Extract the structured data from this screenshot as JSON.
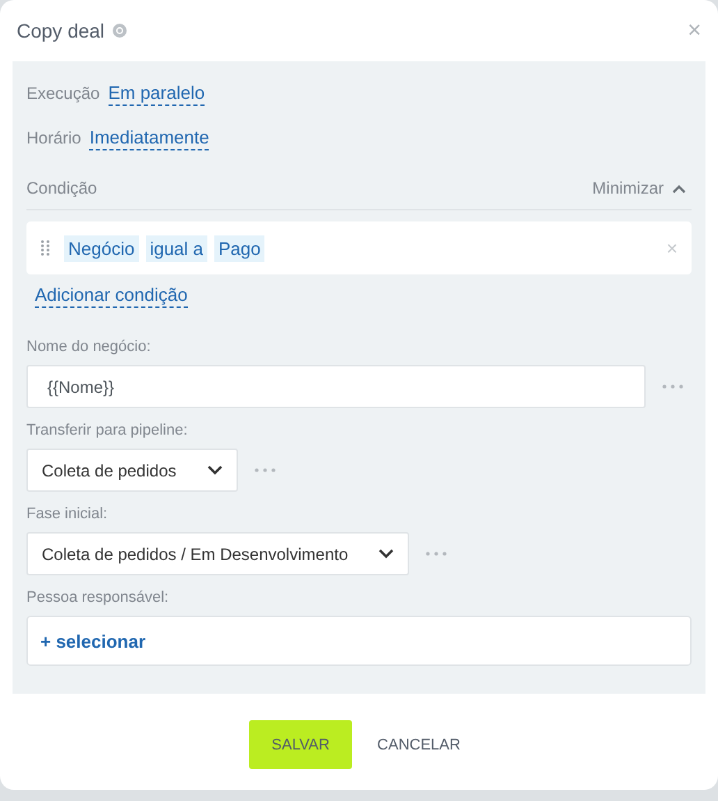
{
  "window": {
    "title": "Copy deal",
    "close": "×"
  },
  "settings": [
    {
      "label": "Execução",
      "value": "Em paralelo"
    },
    {
      "label": "Horário",
      "value": "Imediatamente"
    }
  ],
  "condition": {
    "label": "Condição",
    "toggle": "Minimizar",
    "expanded": true,
    "tokens": [
      "Negócio",
      "igual a",
      "Pago"
    ],
    "remove": "×",
    "add": "Adicionar condição"
  },
  "fields": [
    {
      "kind": "text",
      "label": "Nome do negócio:",
      "value": "{{Nome}}"
    },
    {
      "kind": "select",
      "label": "Transferir para pipeline:",
      "value": "Coleta de pedidos"
    },
    {
      "kind": "select",
      "label": "Fase inicial:",
      "value": "Coleta de pedidos / Em Desenvolvimento"
    },
    {
      "kind": "picker",
      "label": "Pessoa responsável:",
      "value": "+ selecionar"
    }
  ],
  "buttons": [
    {
      "label": "SALVAR",
      "kind": "primary"
    },
    {
      "label": "CANCELAR",
      "kind": "link"
    }
  ]
}
